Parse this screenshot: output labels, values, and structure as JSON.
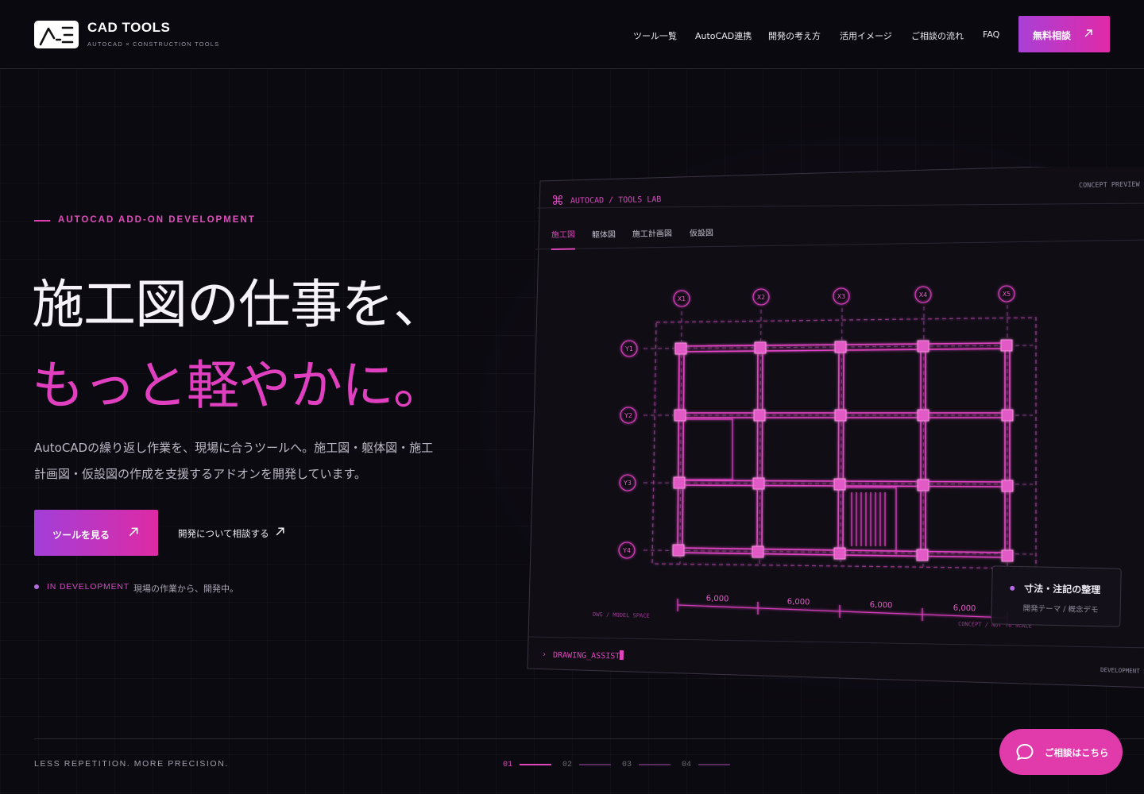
{
  "brand": {
    "title": "CAD TOOLS",
    "subtitle": "AUTOCAD × CONSTRUCTION TOOLS",
    "logo_icon": "ae-logo"
  },
  "nav": {
    "items": [
      "ツール一覧",
      "AutoCAD連携",
      "開発の考え方",
      "活用イメージ",
      "ご相談の流れ",
      "FAQ"
    ],
    "cta": "無料相談"
  },
  "hero": {
    "eyebrow": "AUTOCAD ADD-ON DEVELOPMENT",
    "headline_line1": "施工図の仕事を、",
    "headline_line2": "もっと軽やかに。",
    "lead_line1": "AutoCADの繰り返し作業を、現場に合うツールへ。施工図・躯体図・施工",
    "lead_line2": "計画図・仮設図の作成を支援するアドオンを開発しています。",
    "primary_button": "ツールを見る",
    "secondary_button": "開発について相談する",
    "status_tag": "IN DEVELOPMENT",
    "status_text": "現場の作業から、開発中。"
  },
  "preview": {
    "breadcrumb": "AUTOCAD / TOOLS LAB",
    "badge": "CONCEPT PREVIEW",
    "tabs": [
      "施工図",
      "躯体図",
      "施工計画図",
      "仮設図"
    ],
    "active_tab": "施工図",
    "grid_x": [
      "X1",
      "X2",
      "X3",
      "X4",
      "X5"
    ],
    "grid_y": [
      "Y1",
      "Y2",
      "Y3",
      "Y4"
    ],
    "dimensions": [
      "6,000",
      "6,000",
      "6,000",
      "6,000"
    ],
    "space_label": "DWG / MODEL SPACE",
    "scale_label": "CONCEPT / NOT TO SCALE",
    "console": "DRAWING_ASSIST",
    "footer_label": "DEVELOPMENT S",
    "accent": "#e040bf"
  },
  "float_card": {
    "title": "寸法・注記の整理",
    "subtitle": "開発テーマ / 概念デモ"
  },
  "footer": {
    "tagline": "LESS REPETITION. MORE PRECISION.",
    "pages": [
      "01",
      "02",
      "03",
      "04"
    ],
    "active_page": "01",
    "chat_label": "ご相談はこちら",
    "chat_icon": "chat-bubble-icon"
  }
}
